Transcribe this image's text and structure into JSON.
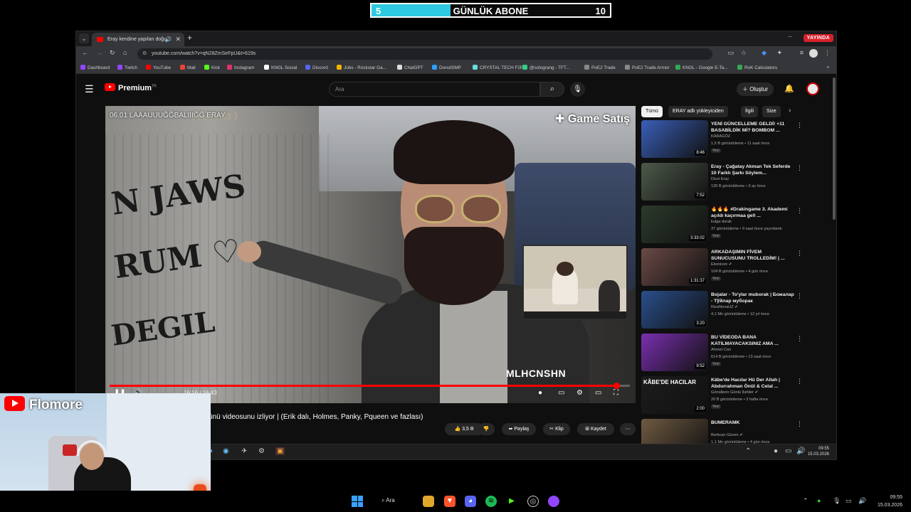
{
  "goal": {
    "left": "5",
    "label": "GÜNLÜK ABONE",
    "right": "10",
    "progress_fraction": 0.33,
    "fill_color": "#2ec9e0"
  },
  "browser": {
    "tab_title": "Eray kendine yapılan doğu...",
    "live_badge": "YAYINDA",
    "url": "youtube.com/watch?v=qN28ZmSeFpU&t=619s",
    "bookmarks": [
      "Dashboard",
      "Twitch",
      "YouTube",
      "Mail",
      "Kick",
      "Instagram",
      "KNGL Social",
      "Discord",
      "Jobs - Rockstar Ga...",
      "ChatGPT",
      "DonutSMP",
      "CRYSTAL TECH F2P",
      "@solograng - TFT...",
      "PoE2 Trade",
      "PoE2 Trade Armor",
      "KNGL - Google E-Ta...",
      "RoK Calculators"
    ]
  },
  "youtube": {
    "logo": "Premium",
    "logo_sup": "TR",
    "search_placeholder": "Ara",
    "create_label": "Oluştur",
    "video": {
      "overlay_title": "06.01 LAAAUUUĞĞBALIIIĞĞ ERAY",
      "overlay_ghost": "(Kevar)",
      "brand": "Game Satış",
      "watermark": "MLHCNSHN",
      "time": "16:16 / 16:43",
      "progress_fraction": 0.974
    },
    "video_title_partial": "ünü videosunu izliyor | (Erik dalı, Holmes, Panky, Pqueen ve fazlası)",
    "actions": {
      "likes": "3,5 B",
      "share": "Paylaş",
      "clip": "Klip",
      "save": "Kaydet"
    },
    "chips": [
      "Tümü",
      "ERAY adlı yükleyiciden",
      "İlgili",
      "Size"
    ],
    "recommended": [
      {
        "title": "YENİ GÜNCELLEME GELDİ! +11 BASABİLDİK Mİ? BOMBOM ...",
        "channel": "KARAGÖZ",
        "meta": "1,5 B görüntüleme • 11 saat önce",
        "badge": "Yeni",
        "duration": "8:46",
        "color": "#3a5fb8"
      },
      {
        "title": "Eray - Çağatay Akman Tek Seferde 10 Farklı Şarkı Söylem...",
        "channel": "Dizzi Eray",
        "meta": "135 B görüntüleme • 3 ay önce",
        "badge": "",
        "duration": "7:52",
        "color": "#4d5a4a"
      },
      {
        "title": "🔥🔥🔥 #Drakingame 3. Akademi açıldı kaçırmaa gell ...",
        "channel": "kulga durak",
        "meta": "37 görüntüleme • 9 saat önce yayınlandı",
        "badge": "Yeni",
        "duration": "3:33:02",
        "color": "#2c3a2c"
      },
      {
        "title": "ARKADAŞIMIN FİVEM SUNUCUSUNU TROLLEDİM! | ...",
        "channel": "Ebonivon ✔",
        "meta": "104 B görüntüleme • 4 gün önce",
        "badge": "Yeni",
        "duration": "1:31:37",
        "color": "#6a4a46"
      },
      {
        "title": "Bojalar - To'ylar muborak | Божалар - Тўйлар муборак",
        "channel": "RizaNovaUZ ✔",
        "meta": "4,1 Mn görüntüleme • 12 yıl önce",
        "badge": "",
        "duration": "3:20",
        "color": "#2a4f8c"
      },
      {
        "title": "BU VİDEODA BANA KATILMAYACAKSINIZ AMA ...",
        "channel": "Ahmet Can",
        "meta": "614 B görüntüleme • 13 saat önce",
        "badge": "Yeni",
        "duration": "9:52",
        "color": "#7a2fb0"
      },
      {
        "title": "Kâbe'de Hacılar Hü Der Allah | Abdurrahman Önül & Celal ...",
        "channel": "Gönüllerin Gönlü İlahiler ✔",
        "meta": "20 B görüntüleme • 3 hafta önce",
        "badge": "Yeni",
        "duration": "2:00",
        "color": "#1c1c1c",
        "thumb_text": "KÂBE'DE HACILAR"
      },
      {
        "title": "BUMERAMK",
        "channel": "Berkcan Güven ✔",
        "meta": "1,1 Mn görüntüleme • 4 gün önce",
        "badge": "",
        "duration": "",
        "color": "#6f5a42"
      }
    ]
  },
  "inner_taskbar": {
    "time": "09:55",
    "date": "15.03.2026"
  },
  "cam": {
    "brand": "Flomore"
  },
  "taskbar": {
    "search": "Ara",
    "time": "09:55",
    "date": "15.03.2026"
  }
}
